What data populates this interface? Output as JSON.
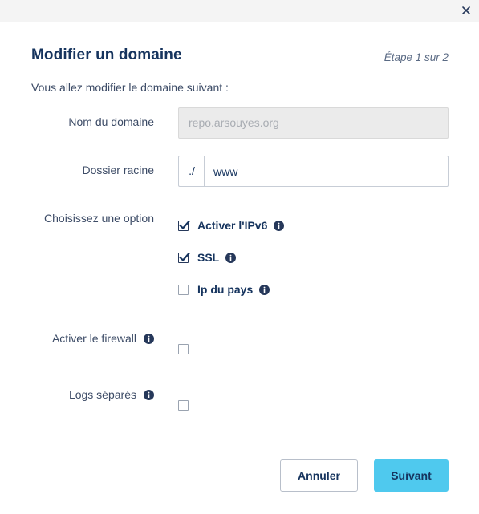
{
  "dialog": {
    "title": "Modifier un domaine",
    "step": "Étape 1 sur 2",
    "intro": "Vous allez modifier le domaine suivant :"
  },
  "fields": {
    "domain_label": "Nom du domaine",
    "domain_value": "repo.arsouyes.org",
    "root_label": "Dossier racine",
    "root_prefix": "./",
    "root_value": "www",
    "option_label": "Choisissez une option",
    "options": [
      {
        "label": "Activer l'IPv6",
        "checked": true
      },
      {
        "label": "SSL",
        "checked": true
      },
      {
        "label": "Ip du pays",
        "checked": false
      }
    ],
    "firewall_label": "Activer le firewall",
    "firewall_checked": false,
    "logs_label": "Logs séparés",
    "logs_checked": false
  },
  "buttons": {
    "cancel": "Annuler",
    "next": "Suivant"
  },
  "colors": {
    "primary_button": "#4fc9ee",
    "title": "#16345e",
    "topbar": "#f4f4f4"
  },
  "icons": [
    "close-icon",
    "info-icon",
    "checkmark-icon"
  ]
}
